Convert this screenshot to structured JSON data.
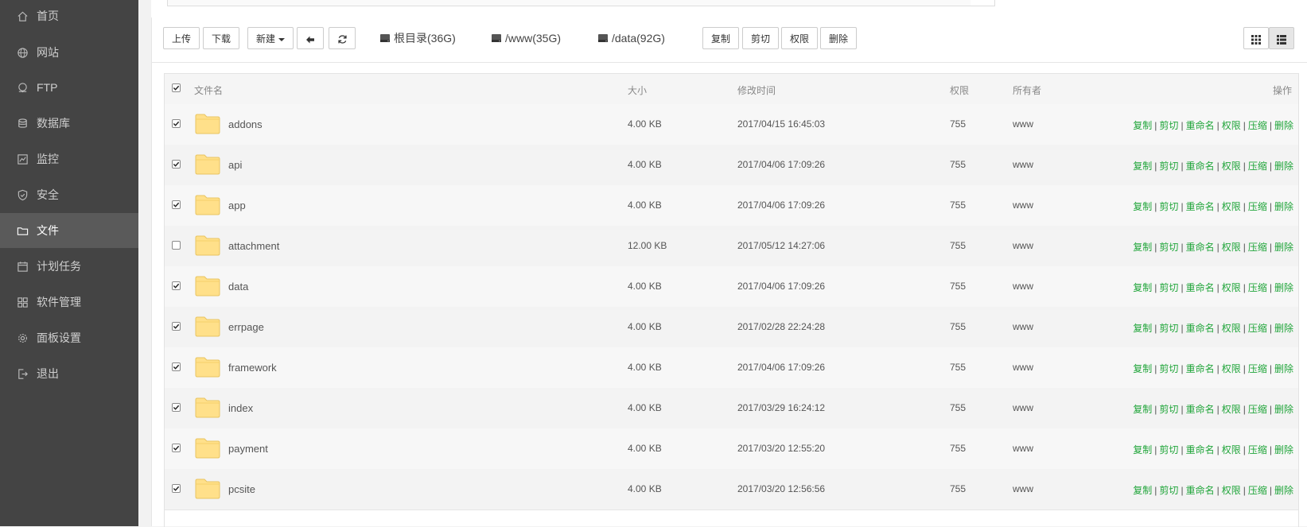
{
  "sidebar": {
    "items": [
      {
        "label": "首页",
        "icon": "home-icon"
      },
      {
        "label": "网站",
        "icon": "globe-icon"
      },
      {
        "label": "FTP",
        "icon": "ftp-icon"
      },
      {
        "label": "数据库",
        "icon": "database-icon"
      },
      {
        "label": "监控",
        "icon": "monitor-icon"
      },
      {
        "label": "安全",
        "icon": "shield-icon"
      },
      {
        "label": "文件",
        "icon": "folder-icon",
        "active": true
      },
      {
        "label": "计划任务",
        "icon": "calendar-icon"
      },
      {
        "label": "软件管理",
        "icon": "apps-icon"
      },
      {
        "label": "面板设置",
        "icon": "gear-icon"
      },
      {
        "label": "退出",
        "icon": "logout-icon"
      }
    ]
  },
  "toolbar": {
    "upload": "上传",
    "download": "下载",
    "new": "新建",
    "copy": "复制",
    "cut": "剪切",
    "permission": "权限",
    "delete": "删除",
    "disks": [
      {
        "label": "根目录(36G)"
      },
      {
        "label": "/www(35G)"
      },
      {
        "label": "/data(92G)"
      }
    ]
  },
  "table": {
    "headers": {
      "name": "文件名",
      "size": "大小",
      "mtime": "修改时间",
      "perm": "权限",
      "owner": "所有者",
      "ops": "操作"
    },
    "ops": [
      "复制",
      "剪切",
      "重命名",
      "权限",
      "压缩",
      "删除"
    ],
    "rows": [
      {
        "name": "addons",
        "size": "4.00 KB",
        "mtime": "2017/04/15 16:45:03",
        "perm": "755",
        "owner": "www",
        "checked": true
      },
      {
        "name": "api",
        "size": "4.00 KB",
        "mtime": "2017/04/06 17:09:26",
        "perm": "755",
        "owner": "www",
        "checked": true
      },
      {
        "name": "app",
        "size": "4.00 KB",
        "mtime": "2017/04/06 17:09:26",
        "perm": "755",
        "owner": "www",
        "checked": true
      },
      {
        "name": "attachment",
        "size": "12.00 KB",
        "mtime": "2017/05/12 14:27:06",
        "perm": "755",
        "owner": "www",
        "checked": false
      },
      {
        "name": "data",
        "size": "4.00 KB",
        "mtime": "2017/04/06 17:09:26",
        "perm": "755",
        "owner": "www",
        "checked": true
      },
      {
        "name": "errpage",
        "size": "4.00 KB",
        "mtime": "2017/02/28 22:24:28",
        "perm": "755",
        "owner": "www",
        "checked": true
      },
      {
        "name": "framework",
        "size": "4.00 KB",
        "mtime": "2017/04/06 17:09:26",
        "perm": "755",
        "owner": "www",
        "checked": true
      },
      {
        "name": "index",
        "size": "4.00 KB",
        "mtime": "2017/03/29 16:24:12",
        "perm": "755",
        "owner": "www",
        "checked": true
      },
      {
        "name": "payment",
        "size": "4.00 KB",
        "mtime": "2017/03/20 12:55:20",
        "perm": "755",
        "owner": "www",
        "checked": true
      },
      {
        "name": "pcsite",
        "size": "4.00 KB",
        "mtime": "2017/03/20 12:56:56",
        "perm": "755",
        "owner": "www",
        "checked": true
      }
    ]
  },
  "colors": {
    "sidebar_bg": "#444444",
    "sidebar_active": "#5a5a5a",
    "link_green": "#20a53a",
    "folder_yellow": "#ffe08a"
  }
}
